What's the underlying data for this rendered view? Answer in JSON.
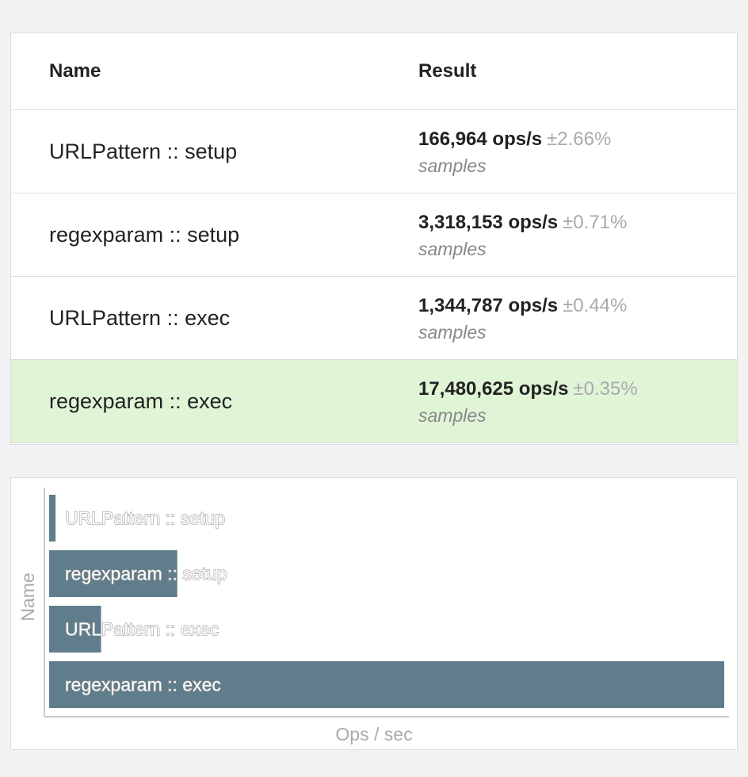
{
  "table": {
    "headers": {
      "name": "Name",
      "result": "Result"
    },
    "rows": [
      {
        "name": "URLPattern :: setup",
        "ops": "166,964 ops/s",
        "error": "±2.66%",
        "samples": "samples",
        "fastest": false
      },
      {
        "name": "regexparam :: setup",
        "ops": "3,318,153 ops/s",
        "error": "±0.71%",
        "samples": "samples",
        "fastest": false
      },
      {
        "name": "URLPattern :: exec",
        "ops": "1,344,787 ops/s",
        "error": "±0.44%",
        "samples": "samples",
        "fastest": false
      },
      {
        "name": "regexparam :: exec",
        "ops": "17,480,625 ops/s",
        "error": "±0.35%",
        "samples": "samples",
        "fastest": true
      }
    ],
    "highlight_color": "#dff5d6"
  },
  "chart_data": {
    "type": "bar",
    "orientation": "horizontal",
    "categories": [
      "URLPattern :: setup",
      "regexparam :: setup",
      "URLPattern :: exec",
      "regexparam :: exec"
    ],
    "values": [
      166964,
      3318153,
      1344787,
      17480625
    ],
    "xlabel": "Ops / sec",
    "ylabel": "Name",
    "xlim": [
      0,
      17480625
    ],
    "bar_color": "#607d8b",
    "grid": false
  }
}
